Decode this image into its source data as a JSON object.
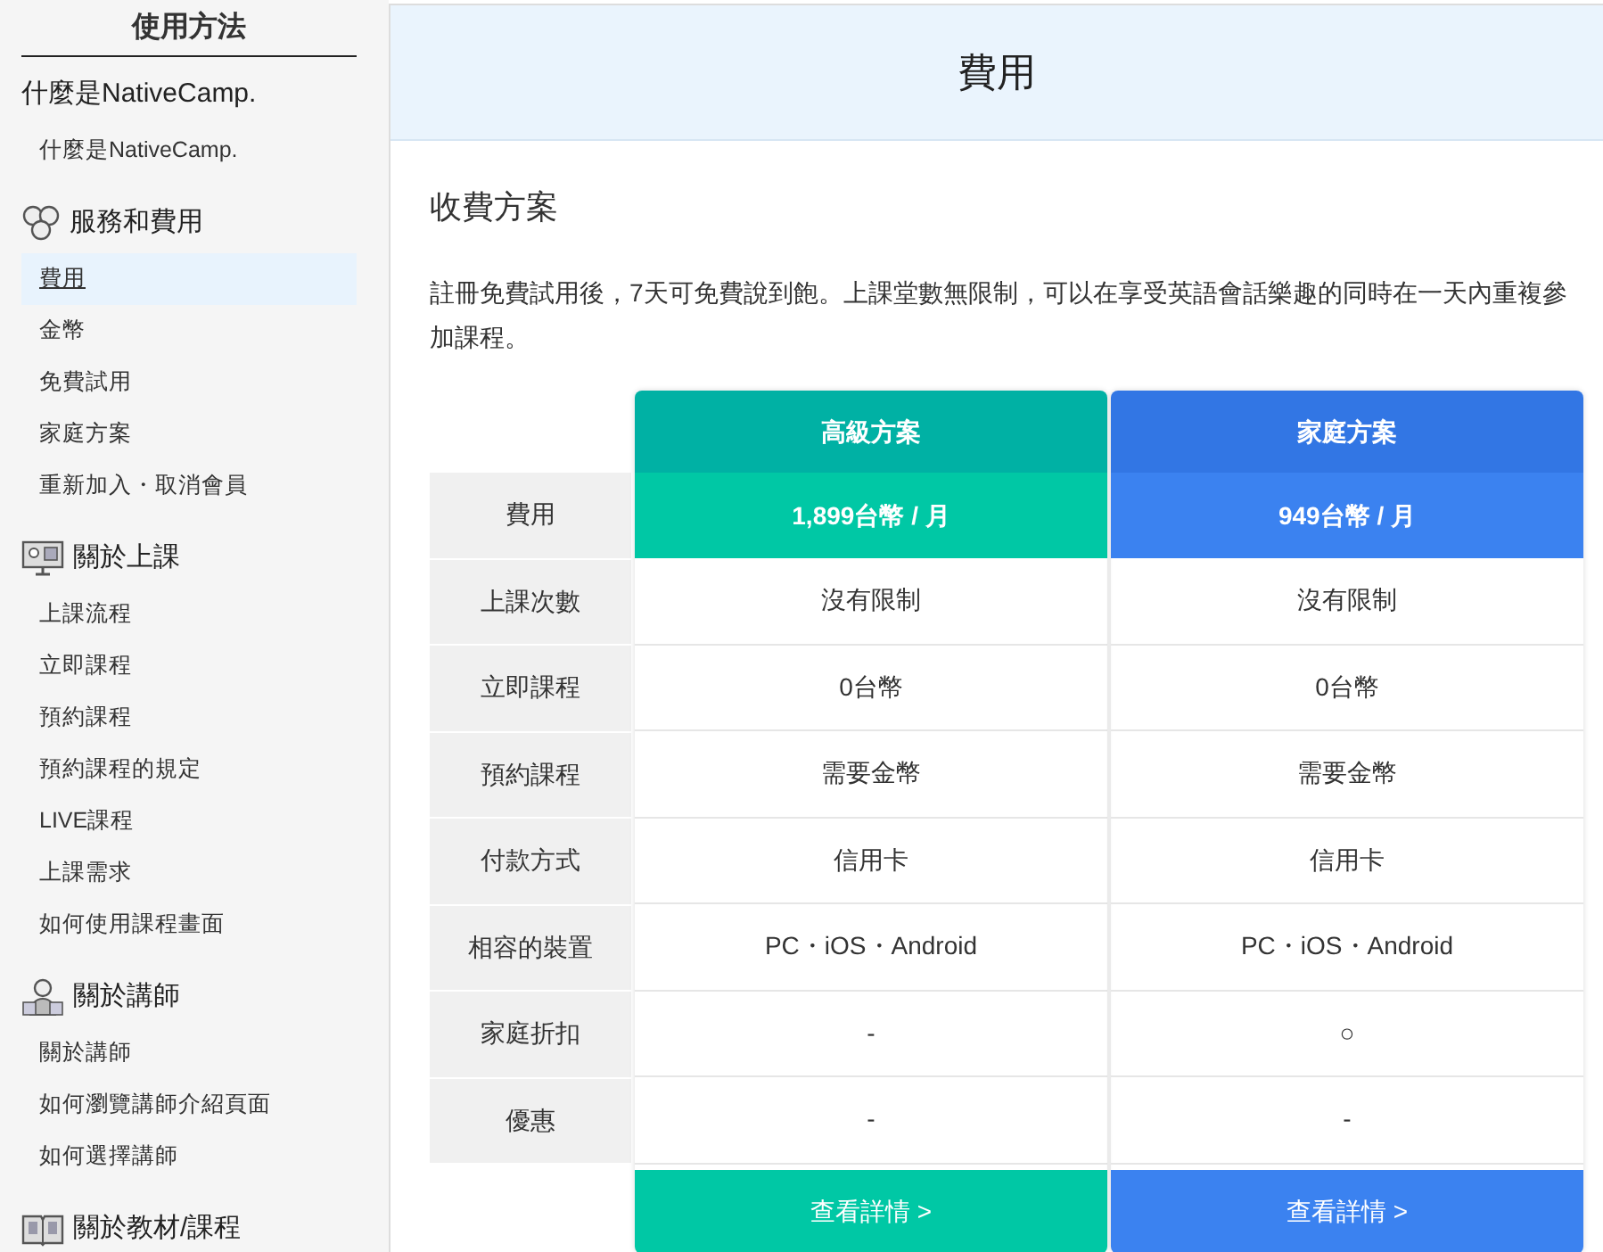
{
  "sidebar": {
    "title": "使用方法",
    "sections": [
      {
        "title": "什麼是NativeCamp.",
        "items": [
          {
            "label": "什麼是NativeCamp.",
            "selected": false
          }
        ]
      },
      {
        "title": "服務和費用",
        "items": [
          {
            "label": "費用",
            "selected": true
          },
          {
            "label": "金幣",
            "selected": false
          },
          {
            "label": "免費試用",
            "selected": false
          },
          {
            "label": "家庭方案",
            "selected": false
          },
          {
            "label": "重新加入・取消會員",
            "selected": false
          }
        ]
      },
      {
        "title": "關於上課",
        "items": [
          {
            "label": "上課流程",
            "selected": false
          },
          {
            "label": "立即課程",
            "selected": false
          },
          {
            "label": "預約課程",
            "selected": false
          },
          {
            "label": "預約課程的規定",
            "selected": false
          },
          {
            "label": "LIVE課程",
            "selected": false
          },
          {
            "label": "上課需求",
            "selected": false
          },
          {
            "label": "如何使用課程畫面",
            "selected": false
          }
        ]
      },
      {
        "title": "關於講師",
        "items": [
          {
            "label": "關於講師",
            "selected": false
          },
          {
            "label": "如何瀏覽講師介紹頁面",
            "selected": false
          },
          {
            "label": "如何選擇講師",
            "selected": false
          }
        ]
      },
      {
        "title": "關於教材/課程"
      }
    ]
  },
  "page": {
    "title": "費用",
    "section_title": "收費方案",
    "description": "註冊免費試用後，7天可免費說到飽。上課堂數無限制，可以在享受英語會話樂趣的同時在一天內重複參加課程。"
  },
  "table": {
    "row_labels": [
      "費用",
      "上課次數",
      "立即課程",
      "預約課程",
      "付款方式",
      "相容的裝置",
      "家庭折扣",
      "優惠"
    ],
    "plans": [
      {
        "name": "高級方案",
        "color": "#00c8a5",
        "price": "1,899台幣 / 月",
        "cells": [
          "沒有限制",
          "0台幣",
          "需要金幣",
          "信用卡",
          "PC・iOS・Android",
          "-",
          "-"
        ],
        "button": "查看詳情 >"
      },
      {
        "name": "家庭方案",
        "color": "#3b82f0",
        "price": "949台幣 / 月",
        "cells": [
          "沒有限制",
          "0台幣",
          "需要金幣",
          "信用卡",
          "PC・iOS・Android",
          "○",
          "-"
        ],
        "button": "查看詳情 >"
      }
    ]
  }
}
